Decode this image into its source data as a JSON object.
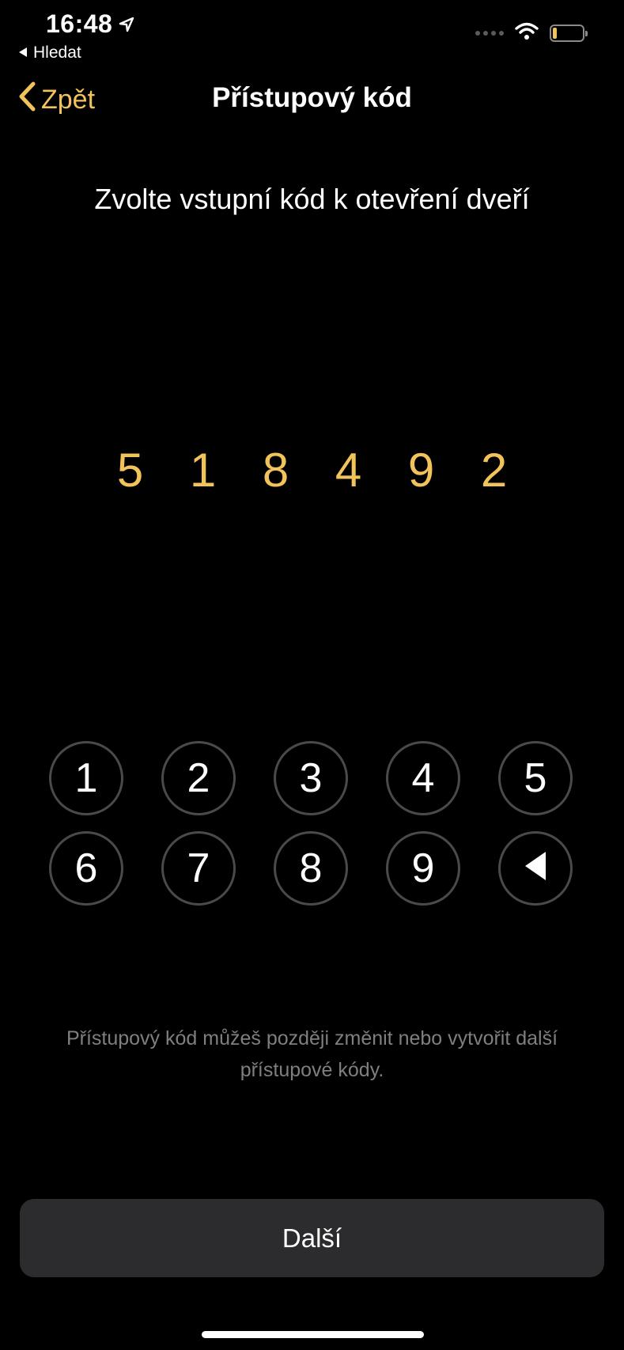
{
  "status_bar": {
    "time": "16:48",
    "back_app": "Hledat",
    "battery_level": 0.15,
    "location_icon": "location-arrow-icon",
    "wifi_icon": "wifi-icon"
  },
  "nav": {
    "back_label": "Zpět",
    "title": "Přístupový kód"
  },
  "prompt": "Zvolte vstupní kód k otevření dveří",
  "code": {
    "digits": [
      "5",
      "1",
      "8",
      "4",
      "9",
      "2"
    ]
  },
  "keypad": {
    "keys": [
      "1",
      "2",
      "3",
      "4",
      "5",
      "6",
      "7",
      "8",
      "9"
    ],
    "delete_icon": "delete-triangle-icon"
  },
  "hint": "Přístupový kód můžeš později změnit nebo vytvořit další přístupové kódy.",
  "next_button": {
    "label": "Další"
  },
  "colors": {
    "accent": "#f2c35a",
    "background": "#000000",
    "key_border": "#4a4a4a",
    "button_bg": "#2c2c2e",
    "hint_text": "#7f7f7f"
  }
}
